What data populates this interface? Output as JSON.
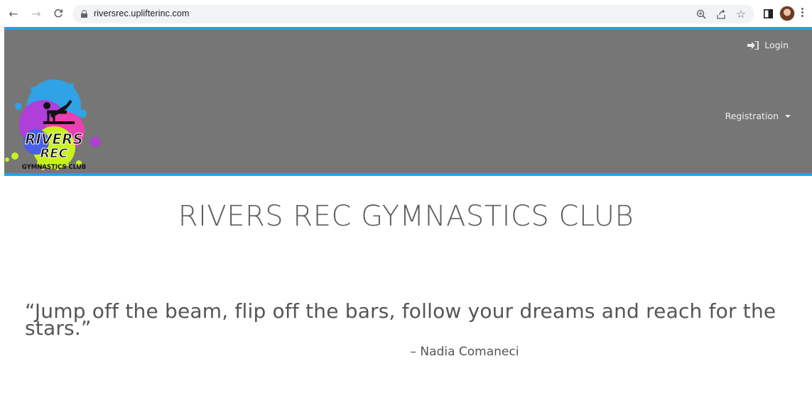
{
  "browser": {
    "url": "riversrec.uplifterinc.com",
    "back_icon": "←",
    "forward_icon": "→",
    "reload_icon": "C",
    "zoom_icon": "⊕",
    "share_icon": "⇪",
    "star_icon": "☆"
  },
  "header": {
    "login_label": "Login",
    "registration_label": "Registration",
    "logo": {
      "line1": "RIVERS",
      "line2": "REC",
      "line3": "GYMNASTICS CLUB"
    },
    "colors": {
      "background": "#767676",
      "accent": "#1ba6e3"
    }
  },
  "main": {
    "title": "RIVERS REC GYMNASTICS CLUB",
    "quote": "“Jump off the beam, flip off the bars, follow your dreams and reach for the stars.”",
    "attribution": "– Nadia Comaneci"
  }
}
